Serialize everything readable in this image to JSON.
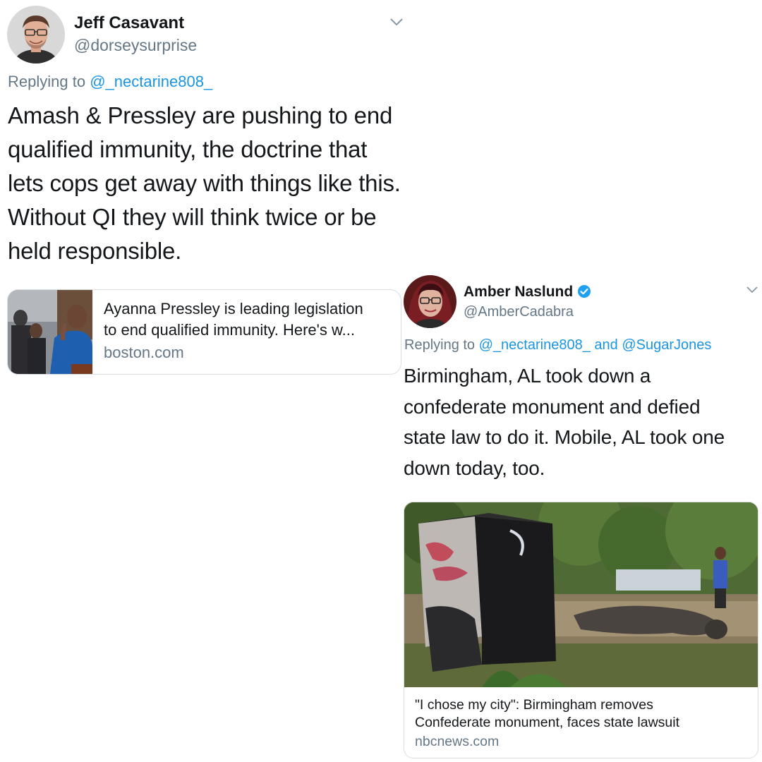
{
  "tweet1": {
    "name": "Jeff Casavant",
    "handle": "@dorseysurprise",
    "replying_prefix": "Replying to ",
    "replying_to": "@_nectarine808_",
    "lines": [
      "Amash & Pressley are pushing to end",
      "qualified immunity, the doctrine that",
      "lets cops get away with things like this.",
      "Without QI they will think twice or be",
      "held responsible."
    ],
    "card": {
      "title_lines": [
        "Ayanna Pressley is leading legislation",
        "to end qualified immunity. Here's w..."
      ],
      "domain": "boston.com"
    }
  },
  "tweet2": {
    "name": "Amber Naslund",
    "handle": "@AmberCadabra",
    "replying_prefix": "Replying to ",
    "replying_to": "@_nectarine808_",
    "replying_and": " and ",
    "replying_to_2": "@SugarJones",
    "lines": [
      "Birmingham, AL took down a",
      "confederate monument and defied",
      "state law to do it. Mobile, AL took one",
      "down today, too."
    ],
    "card": {
      "title_lines": [
        "\"I chose my city\": Birmingham removes",
        "Confederate monument, faces state lawsuit"
      ],
      "domain": "nbcnews.com"
    }
  },
  "icons": {
    "verified": "verified-badge-icon",
    "chevron": "chevron-down-icon"
  },
  "colors": {
    "link": "#1b95e0",
    "secondary_text": "#657786",
    "verified": "#1da1f2"
  }
}
